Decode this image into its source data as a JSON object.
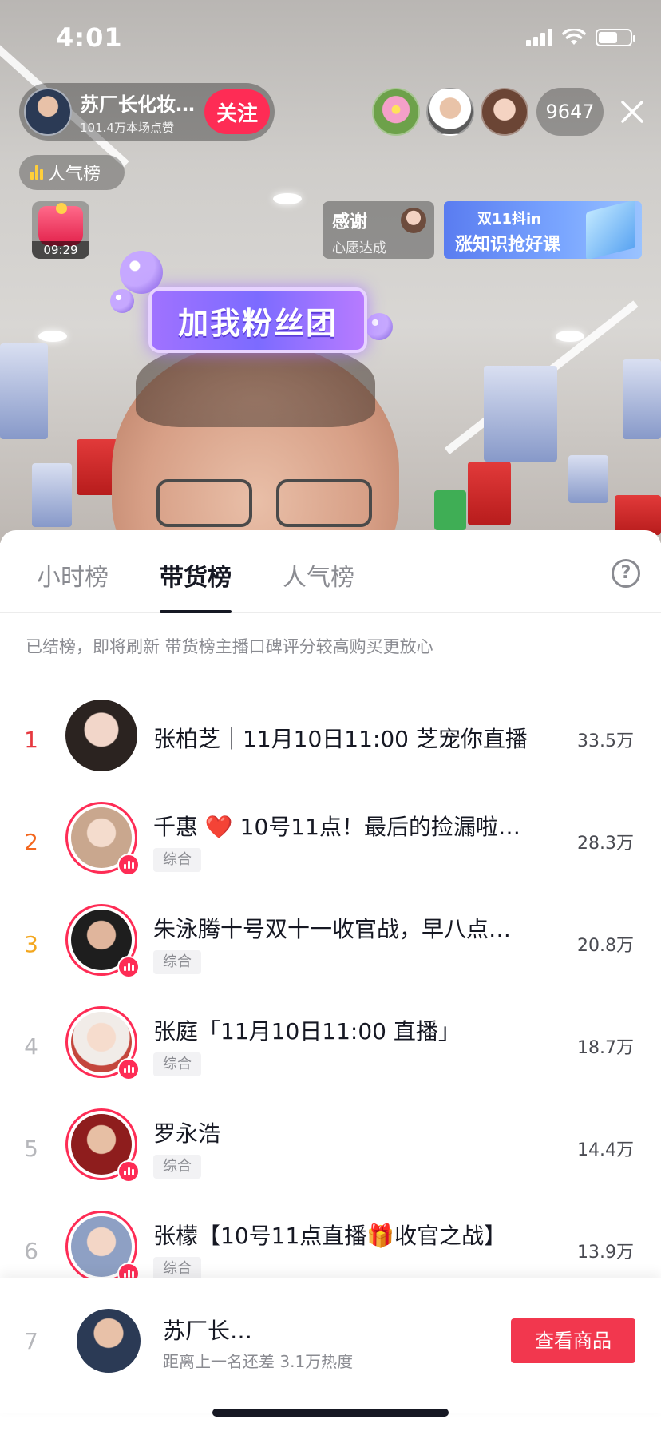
{
  "status_bar": {
    "time": "4:01"
  },
  "host": {
    "name": "苏厂长化妆…",
    "likes": "101.4万本场点赞",
    "follow_label": "关注"
  },
  "viewers": {
    "count": "9647"
  },
  "popularity": {
    "label": "人气榜"
  },
  "gift": {
    "timer": "09:29"
  },
  "thanks": {
    "title": "感谢",
    "subtitle": "心愿达成"
  },
  "promo": {
    "line1": "双11抖in",
    "line2": "涨知识抢好课"
  },
  "fan_club": {
    "label": "加我粉丝团"
  },
  "tabs": [
    {
      "label": "小时榜"
    },
    {
      "label": "带货榜"
    },
    {
      "label": "人气榜"
    }
  ],
  "active_tab_index": 1,
  "help_icon": "?",
  "notice": "已结榜，即将刷新 带货榜主播口碑评分较高购买更放心",
  "ranking": [
    {
      "rank": "1",
      "name": "张柏芝｜11月10日11:00 芝宠你直播",
      "tag": "",
      "score": "33.5万"
    },
    {
      "rank": "2",
      "name_before": "千惠 ",
      "heart": "❤️",
      "name_after": " 10号11点！最后的捡漏啦…",
      "tag": "综合",
      "score": "28.3万"
    },
    {
      "rank": "3",
      "name": "朱泳腾十号双十一收官战，早八点…",
      "tag": "综合",
      "score": "20.8万"
    },
    {
      "rank": "4",
      "name": "张庭「11月10日11:00 直播」",
      "tag": "综合",
      "score": "18.7万"
    },
    {
      "rank": "5",
      "name": "罗永浩",
      "tag": "综合",
      "score": "14.4万"
    },
    {
      "rank": "6",
      "name": "张檬【10号11点直播🎁收官之战】",
      "tag": "综合",
      "score": "13.9万"
    }
  ],
  "self_row": {
    "rank": "7",
    "name": "苏厂长…",
    "gap_text": "距离上一名还差 3.1万热度",
    "button_label": "查看商品"
  },
  "colors": {
    "accent": "#fe2c55",
    "rank1": "#e6383f",
    "rank2": "#f3671f",
    "rank3": "#f3a71f",
    "button": "#f2374e"
  }
}
